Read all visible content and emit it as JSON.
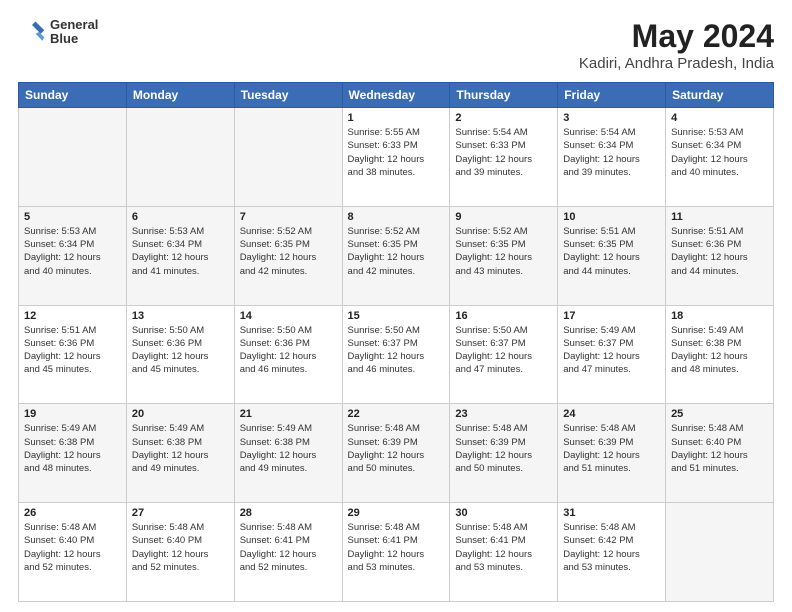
{
  "header": {
    "logo_line1": "General",
    "logo_line2": "Blue",
    "title": "May 2024",
    "subtitle": "Kadiri, Andhra Pradesh, India"
  },
  "weekdays": [
    "Sunday",
    "Monday",
    "Tuesday",
    "Wednesday",
    "Thursday",
    "Friday",
    "Saturday"
  ],
  "weeks": [
    [
      {
        "num": "",
        "info": ""
      },
      {
        "num": "",
        "info": ""
      },
      {
        "num": "",
        "info": ""
      },
      {
        "num": "1",
        "info": "Sunrise: 5:55 AM\nSunset: 6:33 PM\nDaylight: 12 hours\nand 38 minutes."
      },
      {
        "num": "2",
        "info": "Sunrise: 5:54 AM\nSunset: 6:33 PM\nDaylight: 12 hours\nand 39 minutes."
      },
      {
        "num": "3",
        "info": "Sunrise: 5:54 AM\nSunset: 6:34 PM\nDaylight: 12 hours\nand 39 minutes."
      },
      {
        "num": "4",
        "info": "Sunrise: 5:53 AM\nSunset: 6:34 PM\nDaylight: 12 hours\nand 40 minutes."
      }
    ],
    [
      {
        "num": "5",
        "info": "Sunrise: 5:53 AM\nSunset: 6:34 PM\nDaylight: 12 hours\nand 40 minutes."
      },
      {
        "num": "6",
        "info": "Sunrise: 5:53 AM\nSunset: 6:34 PM\nDaylight: 12 hours\nand 41 minutes."
      },
      {
        "num": "7",
        "info": "Sunrise: 5:52 AM\nSunset: 6:35 PM\nDaylight: 12 hours\nand 42 minutes."
      },
      {
        "num": "8",
        "info": "Sunrise: 5:52 AM\nSunset: 6:35 PM\nDaylight: 12 hours\nand 42 minutes."
      },
      {
        "num": "9",
        "info": "Sunrise: 5:52 AM\nSunset: 6:35 PM\nDaylight: 12 hours\nand 43 minutes."
      },
      {
        "num": "10",
        "info": "Sunrise: 5:51 AM\nSunset: 6:35 PM\nDaylight: 12 hours\nand 44 minutes."
      },
      {
        "num": "11",
        "info": "Sunrise: 5:51 AM\nSunset: 6:36 PM\nDaylight: 12 hours\nand 44 minutes."
      }
    ],
    [
      {
        "num": "12",
        "info": "Sunrise: 5:51 AM\nSunset: 6:36 PM\nDaylight: 12 hours\nand 45 minutes."
      },
      {
        "num": "13",
        "info": "Sunrise: 5:50 AM\nSunset: 6:36 PM\nDaylight: 12 hours\nand 45 minutes."
      },
      {
        "num": "14",
        "info": "Sunrise: 5:50 AM\nSunset: 6:36 PM\nDaylight: 12 hours\nand 46 minutes."
      },
      {
        "num": "15",
        "info": "Sunrise: 5:50 AM\nSunset: 6:37 PM\nDaylight: 12 hours\nand 46 minutes."
      },
      {
        "num": "16",
        "info": "Sunrise: 5:50 AM\nSunset: 6:37 PM\nDaylight: 12 hours\nand 47 minutes."
      },
      {
        "num": "17",
        "info": "Sunrise: 5:49 AM\nSunset: 6:37 PM\nDaylight: 12 hours\nand 47 minutes."
      },
      {
        "num": "18",
        "info": "Sunrise: 5:49 AM\nSunset: 6:38 PM\nDaylight: 12 hours\nand 48 minutes."
      }
    ],
    [
      {
        "num": "19",
        "info": "Sunrise: 5:49 AM\nSunset: 6:38 PM\nDaylight: 12 hours\nand 48 minutes."
      },
      {
        "num": "20",
        "info": "Sunrise: 5:49 AM\nSunset: 6:38 PM\nDaylight: 12 hours\nand 49 minutes."
      },
      {
        "num": "21",
        "info": "Sunrise: 5:49 AM\nSunset: 6:38 PM\nDaylight: 12 hours\nand 49 minutes."
      },
      {
        "num": "22",
        "info": "Sunrise: 5:48 AM\nSunset: 6:39 PM\nDaylight: 12 hours\nand 50 minutes."
      },
      {
        "num": "23",
        "info": "Sunrise: 5:48 AM\nSunset: 6:39 PM\nDaylight: 12 hours\nand 50 minutes."
      },
      {
        "num": "24",
        "info": "Sunrise: 5:48 AM\nSunset: 6:39 PM\nDaylight: 12 hours\nand 51 minutes."
      },
      {
        "num": "25",
        "info": "Sunrise: 5:48 AM\nSunset: 6:40 PM\nDaylight: 12 hours\nand 51 minutes."
      }
    ],
    [
      {
        "num": "26",
        "info": "Sunrise: 5:48 AM\nSunset: 6:40 PM\nDaylight: 12 hours\nand 52 minutes."
      },
      {
        "num": "27",
        "info": "Sunrise: 5:48 AM\nSunset: 6:40 PM\nDaylight: 12 hours\nand 52 minutes."
      },
      {
        "num": "28",
        "info": "Sunrise: 5:48 AM\nSunset: 6:41 PM\nDaylight: 12 hours\nand 52 minutes."
      },
      {
        "num": "29",
        "info": "Sunrise: 5:48 AM\nSunset: 6:41 PM\nDaylight: 12 hours\nand 53 minutes."
      },
      {
        "num": "30",
        "info": "Sunrise: 5:48 AM\nSunset: 6:41 PM\nDaylight: 12 hours\nand 53 minutes."
      },
      {
        "num": "31",
        "info": "Sunrise: 5:48 AM\nSunset: 6:42 PM\nDaylight: 12 hours\nand 53 minutes."
      },
      {
        "num": "",
        "info": ""
      }
    ]
  ]
}
